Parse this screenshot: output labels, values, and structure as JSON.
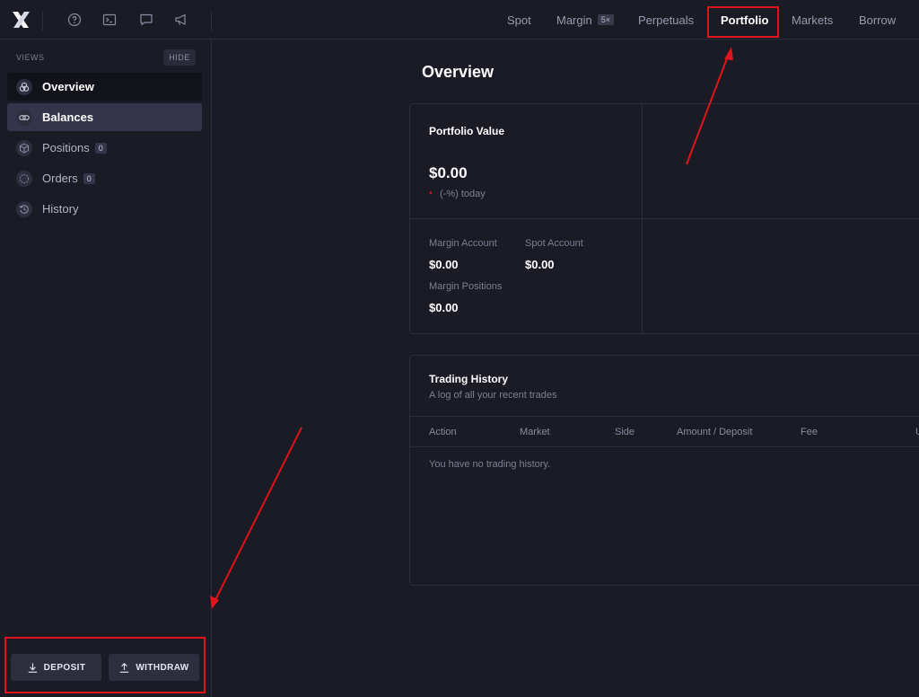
{
  "topbar": {
    "nav": {
      "spot": "Spot",
      "margin": "Margin",
      "margin_badge": "5×",
      "perpetuals": "Perpetuals",
      "portfolio": "Portfolio",
      "markets": "Markets",
      "borrow": "Borrow"
    },
    "icons": [
      "help-circle-icon",
      "terminal-icon",
      "chat-icon",
      "megaphone-icon"
    ]
  },
  "sidebar": {
    "views_label": "VIEWS",
    "hide_label": "HIDE",
    "items": [
      {
        "label": "Overview",
        "icon": "overview-icon",
        "state": "active"
      },
      {
        "label": "Balances",
        "icon": "balances-icon",
        "state": "selected"
      },
      {
        "label": "Positions",
        "icon": "positions-icon",
        "count": "0"
      },
      {
        "label": "Orders",
        "icon": "orders-icon",
        "count": "0"
      },
      {
        "label": "History",
        "icon": "history-icon"
      }
    ],
    "deposit_label": "DEPOSIT",
    "withdraw_label": "WITHDRAW"
  },
  "main": {
    "title": "Overview",
    "portfolio": {
      "title": "Portfolio Value",
      "value": "$0.00",
      "change_marker": "•",
      "change": "(-%) today",
      "margin_account_label": "Margin Account",
      "margin_account_value": "$0.00",
      "spot_account_label": "Spot Account",
      "spot_account_value": "$0.00",
      "margin_positions_label": "Margin Positions",
      "margin_positions_value": "$0.00"
    },
    "history": {
      "title": "Trading History",
      "subtitle": "A log of all your recent trades",
      "columns": [
        "Action",
        "Market",
        "Side",
        "Amount / Deposit",
        "Fee",
        "U"
      ],
      "empty": "You have no trading history."
    }
  },
  "colors": {
    "background": "#1b1b26",
    "active_item": "#12121a",
    "selected_item": "#34344a",
    "highlight": "#e0141a"
  }
}
